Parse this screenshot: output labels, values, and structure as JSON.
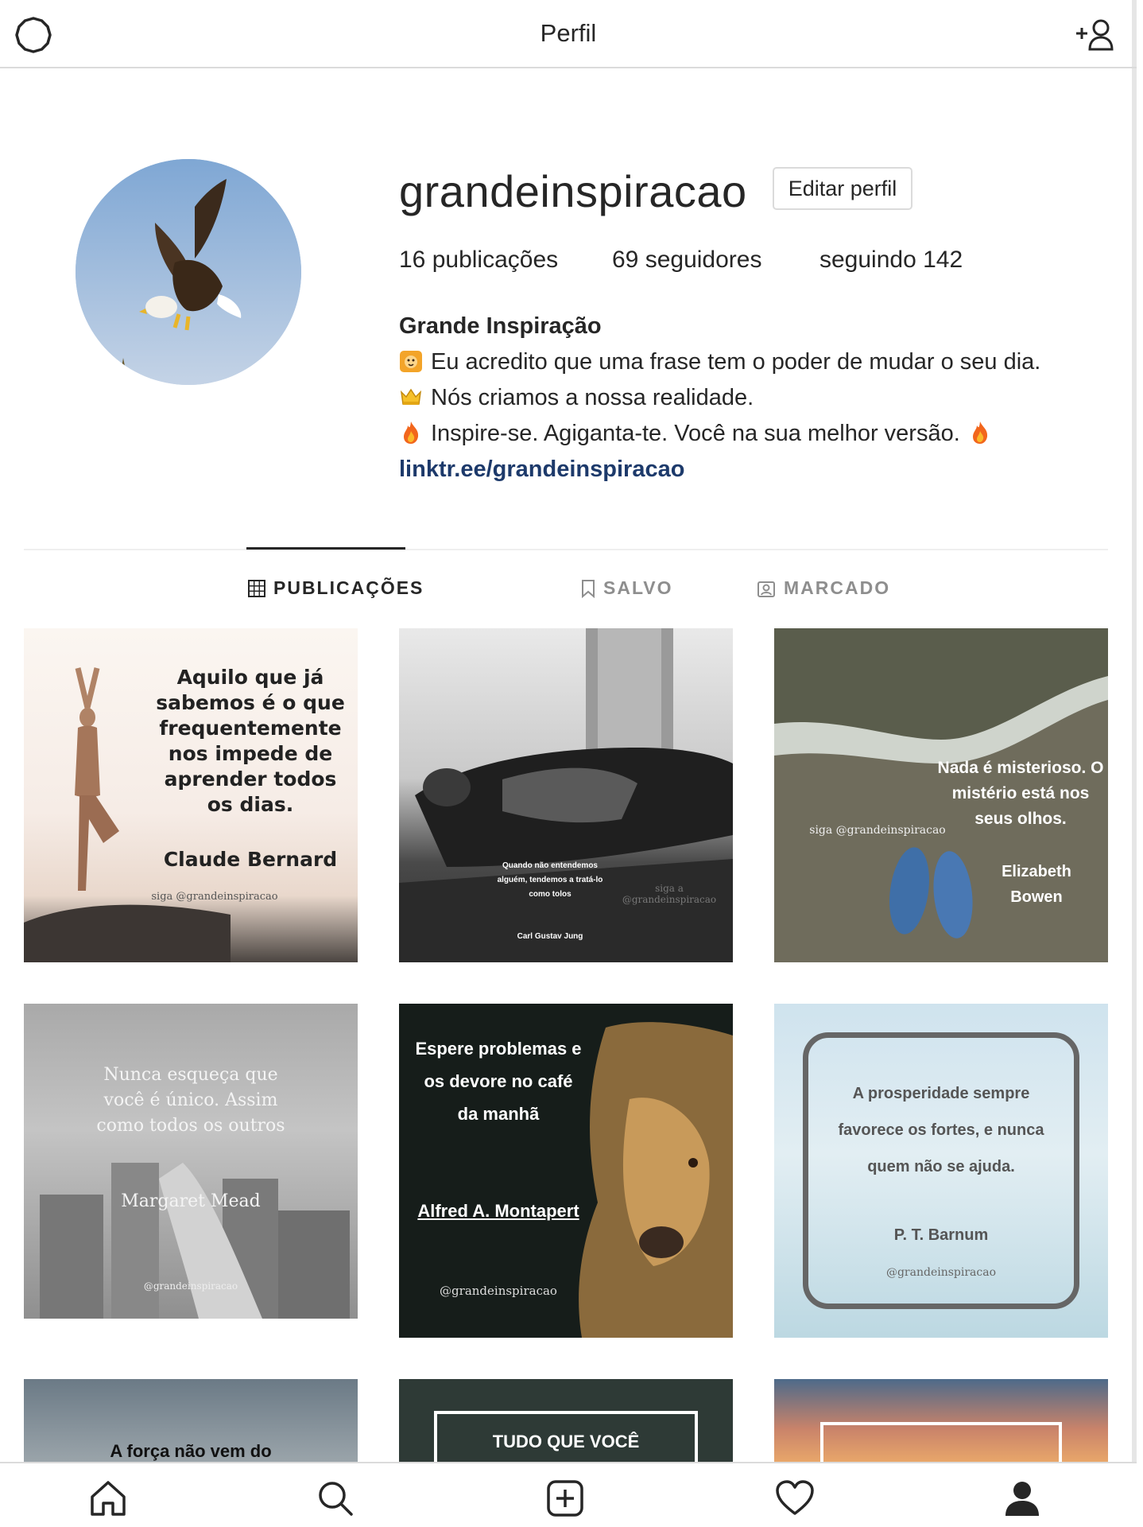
{
  "header": {
    "title": "Perfil"
  },
  "profile": {
    "username": "grandeinspiracao",
    "edit_button": "Editar perfil",
    "stats": {
      "posts": "16 publicações",
      "followers": "69 seguidores",
      "following": "seguindo 142"
    },
    "bio": {
      "name": "Grande Inspiração",
      "line1": "Eu acredito que uma frase tem o poder de mudar o seu dia.",
      "line2": "Nós criamos a nossa realidade.",
      "line3": "Inspire-se. Agiganta-te. Você na sua melhor versão.",
      "link": "linktr.ee/grandeinspiracao"
    }
  },
  "tabs": [
    {
      "label": "PUBLICAÇÕES",
      "active": true
    },
    {
      "label": "SALVO",
      "active": false
    },
    {
      "label": "MARCADO",
      "active": false
    }
  ],
  "posts": [
    {
      "quote": "Aquilo que já sabemos é o que frequentemente nos impede de aprender todos os dias.",
      "author": "Claude Bernard",
      "handle": "siga @grandeinspiracao"
    },
    {
      "quote": "Quando não entendemos alguém, tendemos a tratá-lo como tolos",
      "author": "Carl Gustav Jung",
      "handle": "siga a @grandeinspiracao"
    },
    {
      "quote": "Nada é misterioso. O mistério está nos seus olhos.",
      "author": "Elizabeth Bowen",
      "handle": "siga @grandeinspiracao"
    },
    {
      "quote": "Nunca esqueça que você é único. Assim como todos os outros",
      "author": "Margaret Mead",
      "handle": "@grandeinspiracao"
    },
    {
      "quote": "Espere problemas e os devore no café da manhã",
      "author": "Alfred A. Montapert",
      "handle": "@grandeinspiracao"
    },
    {
      "quote": "A prosperidade sempre favorece os fortes, e nunca quem não se ajuda.",
      "author": "P. T. Barnum",
      "handle": "@grandeinspiracao"
    },
    {
      "quote": "A força não vem do",
      "author": "",
      "handle": ""
    },
    {
      "quote": "TUDO QUE VOCÊ",
      "author": "",
      "handle": ""
    },
    {
      "quote": "",
      "author": "",
      "handle": ""
    }
  ],
  "colors": {
    "link": "#1d3a6b",
    "border": "#dbdbdb",
    "muted": "#8e8e8e"
  },
  "icons": {
    "top_left": "settings-gear-icon",
    "top_right": "add-user-icon",
    "nav": [
      "home-icon",
      "search-icon",
      "new-post-icon",
      "heart-icon",
      "profile-icon"
    ]
  }
}
